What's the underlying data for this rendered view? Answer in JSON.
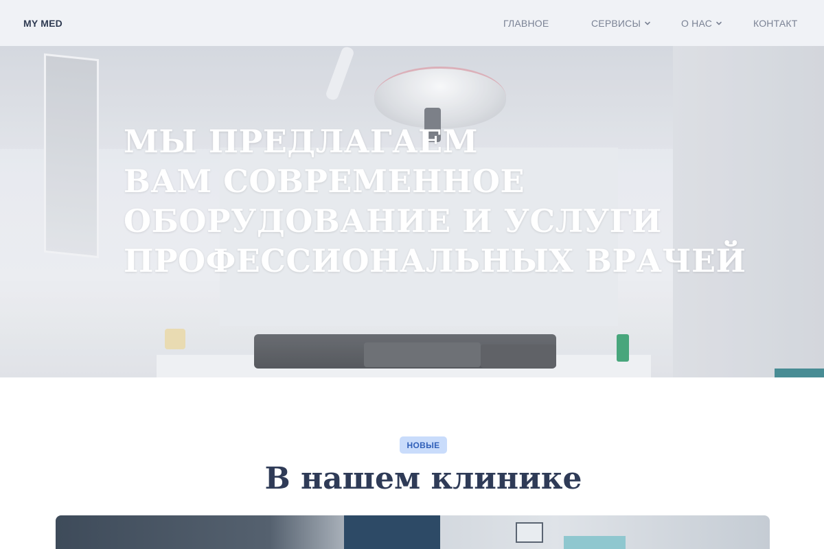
{
  "header": {
    "brand": "MY MED",
    "nav": [
      {
        "label": "ГЛАВНОЕ",
        "has_dropdown": false
      },
      {
        "label": "СЕРВИСЫ",
        "has_dropdown": true
      },
      {
        "label": "О НАС",
        "has_dropdown": true
      },
      {
        "label": "КОНТАКТ",
        "has_dropdown": false
      }
    ]
  },
  "hero": {
    "title_lines": [
      "МЫ ПРЕДЛАГАЕМ",
      "ВАМ СОВРЕМЕННОЕ",
      "ОБОРУДОВАНИЕ И УСЛУГИ",
      "ПРОФЕССИОНАЛЬНЫХ ВРАЧЕЙ"
    ]
  },
  "section": {
    "badge": "НОВЫЕ",
    "title": "В нашем клинике"
  },
  "colors": {
    "header_bg": "#f0f2f6",
    "brand_text": "#2f3b52",
    "nav_text": "#7a8294",
    "badge_bg": "#c9dcfb",
    "badge_text": "#2f5fb8",
    "section_title": "#2f3b57"
  },
  "icons": {
    "dropdown": "chevron-down-icon"
  }
}
